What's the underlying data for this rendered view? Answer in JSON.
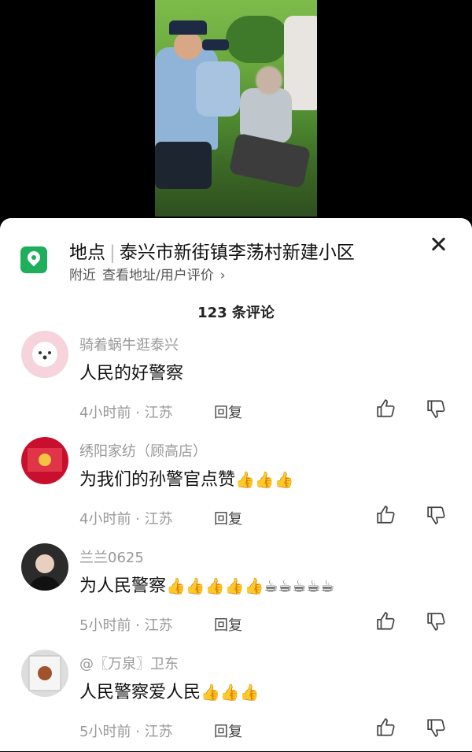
{
  "location": {
    "label": "地点",
    "name": "泰兴市新街镇李荡村新建小区",
    "nearby": "附近",
    "view_link": "查看地址/用户评价",
    "chevron": "›"
  },
  "comment_count": "123 条评论",
  "comments": [
    {
      "user": "骑着蜗牛逛泰兴",
      "text": "人民的好警察",
      "emoji": "",
      "time": "4小时前",
      "region": "江苏",
      "reply": "回复"
    },
    {
      "user": "绣阳家纺（顾高店）",
      "text": "为我们的孙警官点赞",
      "emoji": "👍👍👍",
      "time": "4小时前",
      "region": "江苏",
      "reply": "回复"
    },
    {
      "user": "兰兰0625",
      "text": "为人民警察",
      "emoji": "👍👍👍👍👍☕☕☕☕☕",
      "time": "5小时前",
      "region": "江苏",
      "reply": "回复"
    },
    {
      "user": "@〖万泉〗卫东",
      "text": "人民警察爱人民",
      "emoji": "👍👍👍",
      "time": "5小时前",
      "region": "江苏",
      "reply": "回复"
    }
  ],
  "colors": {
    "accent": "#1fae5b"
  },
  "icons": [
    "location-pin-icon",
    "close-icon",
    "thumbs-up-icon",
    "thumbs-down-icon"
  ]
}
